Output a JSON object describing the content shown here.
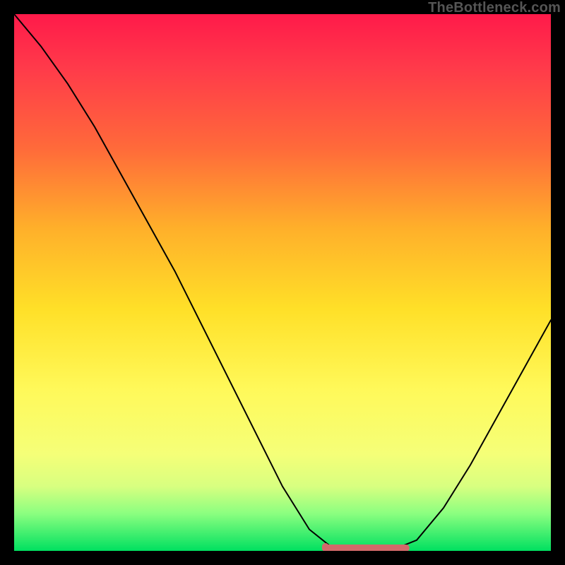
{
  "watermark": "TheBottleneck.com",
  "colors": {
    "gradient_top": "#ff1a4a",
    "gradient_mid1": "#ff6a3a",
    "gradient_mid2": "#ffe028",
    "gradient_mid3": "#fff95a",
    "gradient_bottom": "#00e060",
    "curve_stroke": "#000000",
    "marker_stroke": "#d26a6a",
    "marker_fill": "#d26a6a",
    "frame": "#000000"
  },
  "chart_data": {
    "type": "line",
    "title": "",
    "xlabel": "",
    "ylabel": "",
    "x": [
      0.0,
      0.05,
      0.1,
      0.15,
      0.2,
      0.25,
      0.3,
      0.35,
      0.4,
      0.45,
      0.5,
      0.55,
      0.6,
      0.65,
      0.7,
      0.75,
      0.8,
      0.85,
      0.9,
      0.95,
      1.0
    ],
    "values": [
      1.0,
      0.94,
      0.87,
      0.79,
      0.7,
      0.61,
      0.52,
      0.42,
      0.32,
      0.22,
      0.12,
      0.04,
      0.0,
      0.0,
      0.0,
      0.02,
      0.08,
      0.16,
      0.25,
      0.34,
      0.43
    ],
    "marker_segment": {
      "x_start": 0.58,
      "x_end": 0.73,
      "y": 0.0
    },
    "xlim": [
      0,
      1
    ],
    "ylim": [
      0,
      1
    ],
    "legend": false,
    "grid": false,
    "annotations": []
  }
}
